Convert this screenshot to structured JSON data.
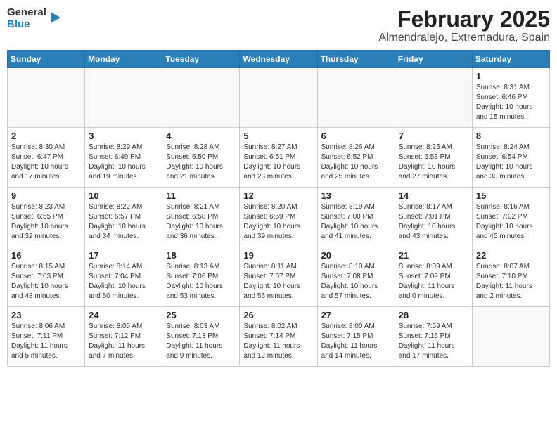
{
  "header": {
    "logo_general": "General",
    "logo_blue": "Blue",
    "title": "February 2025",
    "subtitle": "Almendralejo, Extremadura, Spain"
  },
  "days_of_week": [
    "Sunday",
    "Monday",
    "Tuesday",
    "Wednesday",
    "Thursday",
    "Friday",
    "Saturday"
  ],
  "weeks": [
    [
      {
        "day": "",
        "info": ""
      },
      {
        "day": "",
        "info": ""
      },
      {
        "day": "",
        "info": ""
      },
      {
        "day": "",
        "info": ""
      },
      {
        "day": "",
        "info": ""
      },
      {
        "day": "",
        "info": ""
      },
      {
        "day": "1",
        "info": "Sunrise: 8:31 AM\nSunset: 6:46 PM\nDaylight: 10 hours and 15 minutes."
      }
    ],
    [
      {
        "day": "2",
        "info": "Sunrise: 8:30 AM\nSunset: 6:47 PM\nDaylight: 10 hours and 17 minutes."
      },
      {
        "day": "3",
        "info": "Sunrise: 8:29 AM\nSunset: 6:49 PM\nDaylight: 10 hours and 19 minutes."
      },
      {
        "day": "4",
        "info": "Sunrise: 8:28 AM\nSunset: 6:50 PM\nDaylight: 10 hours and 21 minutes."
      },
      {
        "day": "5",
        "info": "Sunrise: 8:27 AM\nSunset: 6:51 PM\nDaylight: 10 hours and 23 minutes."
      },
      {
        "day": "6",
        "info": "Sunrise: 8:26 AM\nSunset: 6:52 PM\nDaylight: 10 hours and 25 minutes."
      },
      {
        "day": "7",
        "info": "Sunrise: 8:25 AM\nSunset: 6:53 PM\nDaylight: 10 hours and 27 minutes."
      },
      {
        "day": "8",
        "info": "Sunrise: 8:24 AM\nSunset: 6:54 PM\nDaylight: 10 hours and 30 minutes."
      }
    ],
    [
      {
        "day": "9",
        "info": "Sunrise: 8:23 AM\nSunset: 6:55 PM\nDaylight: 10 hours and 32 minutes."
      },
      {
        "day": "10",
        "info": "Sunrise: 8:22 AM\nSunset: 6:57 PM\nDaylight: 10 hours and 34 minutes."
      },
      {
        "day": "11",
        "info": "Sunrise: 8:21 AM\nSunset: 6:58 PM\nDaylight: 10 hours and 36 minutes."
      },
      {
        "day": "12",
        "info": "Sunrise: 8:20 AM\nSunset: 6:59 PM\nDaylight: 10 hours and 39 minutes."
      },
      {
        "day": "13",
        "info": "Sunrise: 8:19 AM\nSunset: 7:00 PM\nDaylight: 10 hours and 41 minutes."
      },
      {
        "day": "14",
        "info": "Sunrise: 8:17 AM\nSunset: 7:01 PM\nDaylight: 10 hours and 43 minutes."
      },
      {
        "day": "15",
        "info": "Sunrise: 8:16 AM\nSunset: 7:02 PM\nDaylight: 10 hours and 45 minutes."
      }
    ],
    [
      {
        "day": "16",
        "info": "Sunrise: 8:15 AM\nSunset: 7:03 PM\nDaylight: 10 hours and 48 minutes."
      },
      {
        "day": "17",
        "info": "Sunrise: 8:14 AM\nSunset: 7:04 PM\nDaylight: 10 hours and 50 minutes."
      },
      {
        "day": "18",
        "info": "Sunrise: 8:13 AM\nSunset: 7:06 PM\nDaylight: 10 hours and 53 minutes."
      },
      {
        "day": "19",
        "info": "Sunrise: 8:11 AM\nSunset: 7:07 PM\nDaylight: 10 hours and 55 minutes."
      },
      {
        "day": "20",
        "info": "Sunrise: 8:10 AM\nSunset: 7:08 PM\nDaylight: 10 hours and 57 minutes."
      },
      {
        "day": "21",
        "info": "Sunrise: 8:09 AM\nSunset: 7:09 PM\nDaylight: 11 hours and 0 minutes."
      },
      {
        "day": "22",
        "info": "Sunrise: 8:07 AM\nSunset: 7:10 PM\nDaylight: 11 hours and 2 minutes."
      }
    ],
    [
      {
        "day": "23",
        "info": "Sunrise: 8:06 AM\nSunset: 7:11 PM\nDaylight: 11 hours and 5 minutes."
      },
      {
        "day": "24",
        "info": "Sunrise: 8:05 AM\nSunset: 7:12 PM\nDaylight: 11 hours and 7 minutes."
      },
      {
        "day": "25",
        "info": "Sunrise: 8:03 AM\nSunset: 7:13 PM\nDaylight: 11 hours and 9 minutes."
      },
      {
        "day": "26",
        "info": "Sunrise: 8:02 AM\nSunset: 7:14 PM\nDaylight: 11 hours and 12 minutes."
      },
      {
        "day": "27",
        "info": "Sunrise: 8:00 AM\nSunset: 7:15 PM\nDaylight: 11 hours and 14 minutes."
      },
      {
        "day": "28",
        "info": "Sunrise: 7:59 AM\nSunset: 7:16 PM\nDaylight: 11 hours and 17 minutes."
      },
      {
        "day": "",
        "info": ""
      }
    ]
  ]
}
